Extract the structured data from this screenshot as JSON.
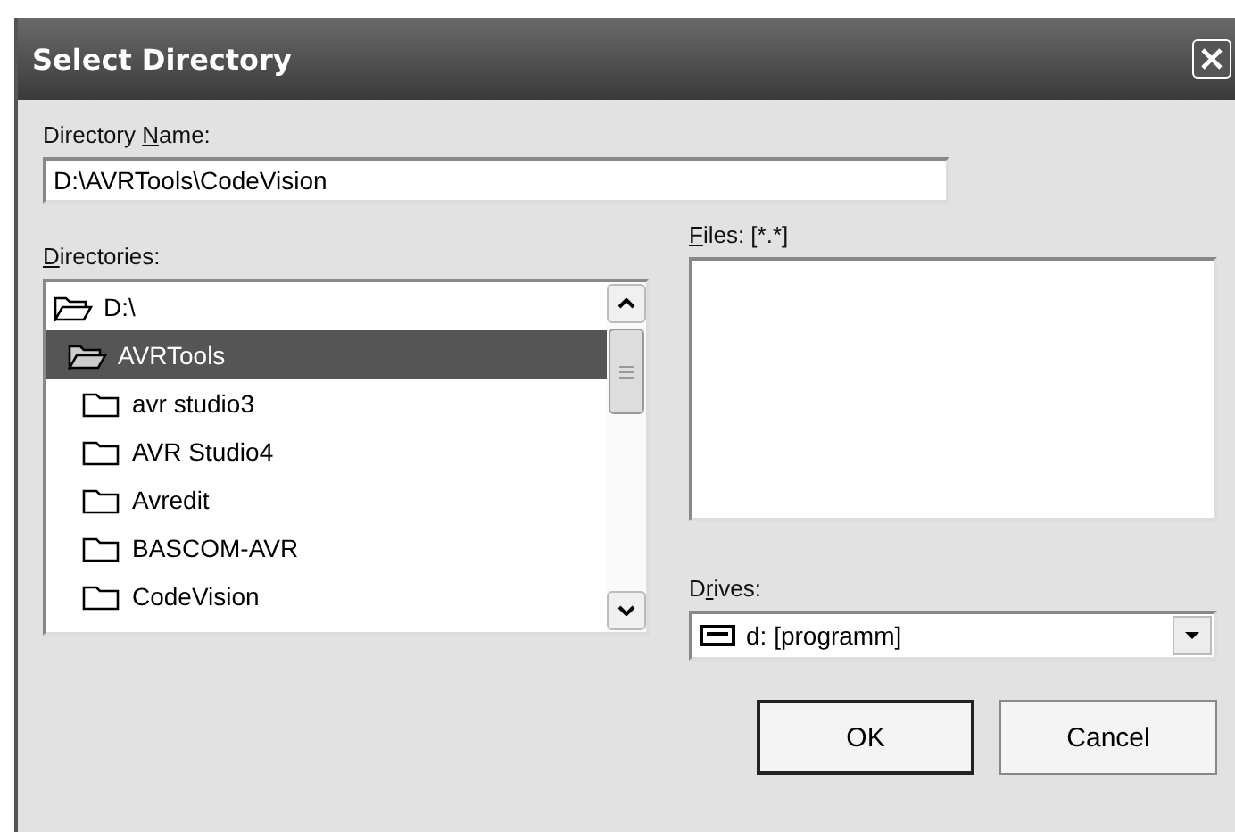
{
  "window": {
    "title": "Select Directory"
  },
  "directory_name": {
    "label": {
      "pre": "Directory ",
      "key": "N",
      "post": "ame:"
    },
    "value": "D:\\AVRTools\\CodeVision"
  },
  "directories": {
    "label": {
      "key": "D",
      "post": "irectories:"
    },
    "items": [
      {
        "name": "D:\\",
        "kind": "open",
        "selected": false,
        "children": [
          {
            "name": "AVRTools",
            "kind": "open",
            "selected": true,
            "children": [
              {
                "name": "avr studio3",
                "kind": "closed",
                "selected": false
              },
              {
                "name": "AVR Studio4",
                "kind": "closed",
                "selected": false
              },
              {
                "name": "Avredit",
                "kind": "closed",
                "selected": false
              },
              {
                "name": "BASCOM-AVR",
                "kind": "closed",
                "selected": false
              },
              {
                "name": "CodeVision",
                "kind": "closed",
                "selected": false
              }
            ]
          }
        ]
      }
    ]
  },
  "files": {
    "label": {
      "key": "F",
      "post": "iles: [*.*]"
    }
  },
  "drives": {
    "label": {
      "pre": "D",
      "key": "r",
      "post": "ives:"
    },
    "value": "d: [programm]"
  },
  "buttons": [
    {
      "label": "OK",
      "default": true
    },
    {
      "label": "Cancel",
      "default": false
    }
  ]
}
